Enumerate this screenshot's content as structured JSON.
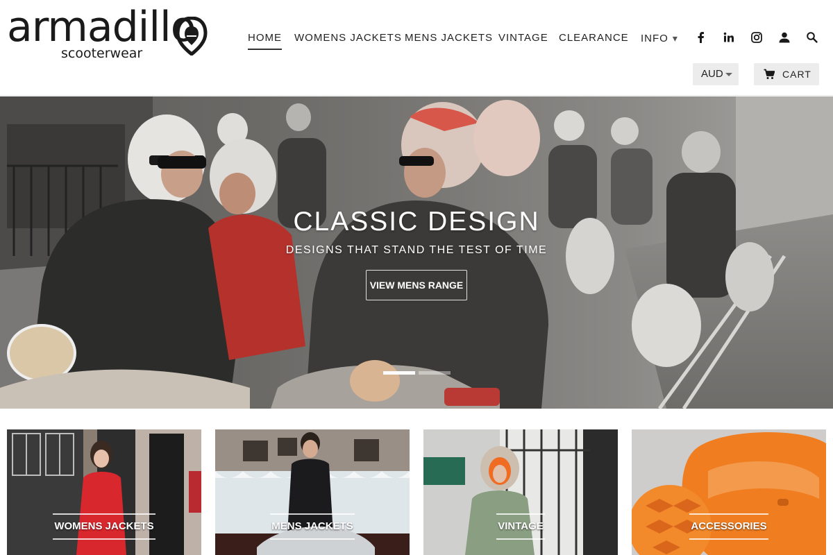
{
  "header": {
    "logo": {
      "wordmark": "armadillo",
      "tagline": "scooterwear",
      "mark_icon": "armadillo-shield-mark"
    },
    "nav": {
      "home": "HOME",
      "womens": "WOMENS JACKETS",
      "mens": "MENS JACKETS",
      "vintage": "VINTAGE",
      "clearance": "CLEARANCE",
      "info": "INFO",
      "info_caret": "▾"
    },
    "social_icons": [
      "facebook-icon",
      "linkedin-icon",
      "instagram-icon",
      "account-icon",
      "search-icon"
    ],
    "currency": {
      "selected": "AUD"
    },
    "cart": {
      "label": "CART",
      "icon": "cart-icon"
    }
  },
  "hero": {
    "title": "CLASSIC DESIGN",
    "subtitle": "DESIGNS THAT STAND THE TEST OF TIME",
    "button": "VIEW MENS RANGE",
    "slides": 2,
    "active_slide": 1
  },
  "collections": [
    {
      "label": "WOMENS JACKETS"
    },
    {
      "label": "MENS JACKETS"
    },
    {
      "label": "VINTAGE"
    },
    {
      "label": "ACCESSORIES"
    }
  ],
  "colors": {
    "text": "#222222",
    "button_bg": "#ececec",
    "accessories_orange": "#f07e21",
    "womens_red": "#d8272d",
    "vintage_green": "#8a9e82"
  }
}
